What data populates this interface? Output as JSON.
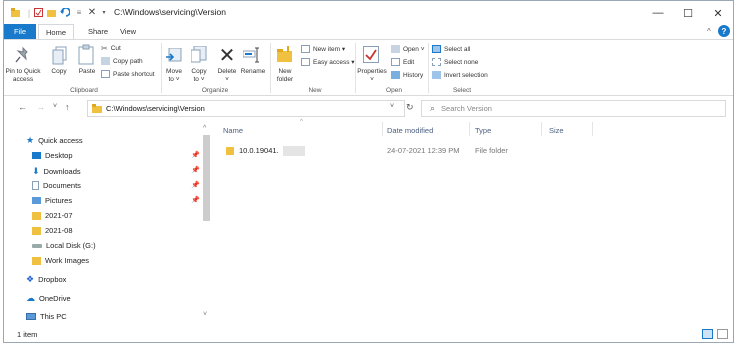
{
  "titlebar": {
    "path": "C:\\Windows\\servicing\\Version",
    "minimize": "—",
    "maximize": "☐",
    "close": "✕"
  },
  "tabs": {
    "file": "File",
    "home": "Home",
    "share": "Share",
    "view": "View"
  },
  "ribbon": {
    "clipboard": {
      "pin_line1": "Pin to Quick",
      "pin_line2": "access",
      "copy": "Copy",
      "paste": "Paste",
      "cut": "Cut",
      "copy_path": "Copy path",
      "paste_shortcut": "Paste shortcut",
      "label": "Clipboard"
    },
    "organize": {
      "move_line1": "Move",
      "move_line2": "to ˅",
      "copy_line1": "Copy",
      "copy_line2": "to ˅",
      "delete_line1": "Delete",
      "delete_line2": "˅",
      "rename": "Rename",
      "label": "Organize"
    },
    "new": {
      "folder_line1": "New",
      "folder_line2": "folder",
      "new_item": "New item ▾",
      "easy_access": "Easy access ▾",
      "label": "New"
    },
    "open": {
      "properties_line1": "Properties",
      "properties_line2": "˅",
      "open_btn": "Open ˅",
      "edit": "Edit",
      "history": "History",
      "label": "Open"
    },
    "select": {
      "select_all": "Select all",
      "select_none": "Select none",
      "invert": "Invert selection",
      "label": "Select"
    }
  },
  "address": {
    "path": "C:\\Windows\\servicing\\Version",
    "search_placeholder": "Search Version"
  },
  "navpane": {
    "quick_access": "Quick access",
    "desktop": "Desktop",
    "downloads": "Downloads",
    "documents": "Documents",
    "pictures": "Pictures",
    "f2021_07": "2021-07",
    "f2021_08": "2021-08",
    "local_disk": "Local Disk (G:)",
    "work_images": "Work Images",
    "dropbox": "Dropbox",
    "onedrive": "OneDrive",
    "this_pc": "This PC"
  },
  "columns": {
    "name": "Name",
    "date": "Date modified",
    "type": "Type",
    "size": "Size"
  },
  "files": [
    {
      "name": "10.0.19041.",
      "date": "24-07-2021 12:39 PM",
      "type": "File folder",
      "size": ""
    }
  ],
  "status": {
    "count": "1 item"
  },
  "colors": {
    "accent": "#1979ca",
    "folder": "#f0c040"
  }
}
